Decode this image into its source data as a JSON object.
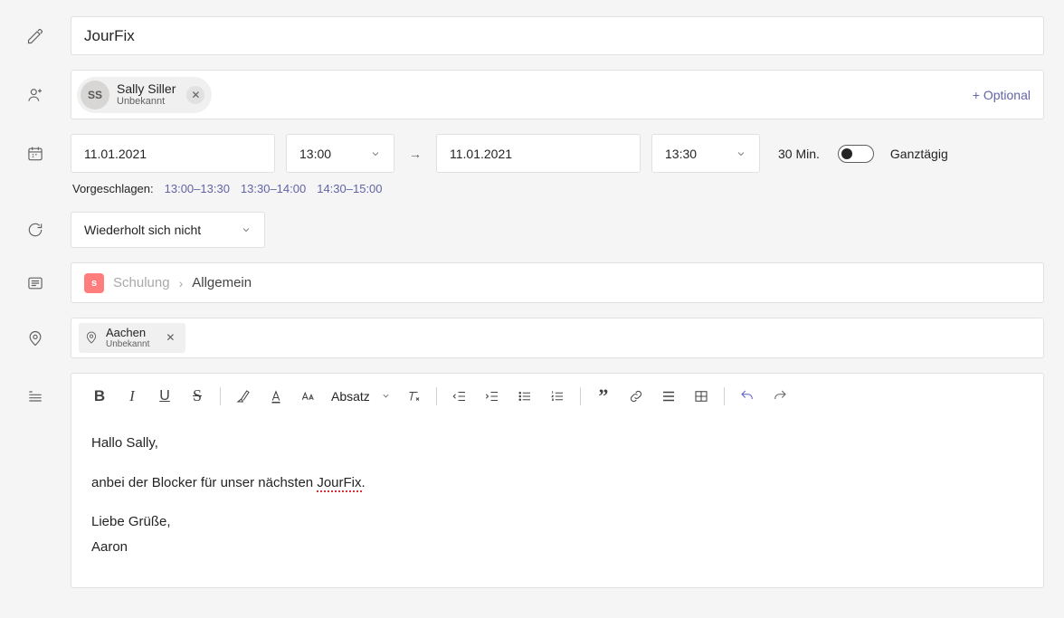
{
  "title": "JourFix",
  "attendees": {
    "chip": {
      "initials": "SS",
      "name": "Sally Siller",
      "sub": "Unbekannt"
    },
    "optional_label": "+ Optional"
  },
  "datetime": {
    "start_date": "11.01.2021",
    "start_time": "13:00",
    "end_date": "11.01.2021",
    "end_time": "13:30",
    "duration": "30 Min.",
    "allday_label": "Ganztägig"
  },
  "suggestions": {
    "label": "Vorgeschlagen:",
    "slots": [
      "13:00–13:30",
      "13:30–14:00",
      "14:30–15:00"
    ]
  },
  "recurrence": {
    "value": "Wiederholt sich nicht"
  },
  "channel": {
    "team": "Schulung",
    "channel_name": "Allgemein"
  },
  "location": {
    "name": "Aachen",
    "sub": "Unbekannt"
  },
  "toolbar": {
    "paragraph_label": "Absatz"
  },
  "body": {
    "line1": "Hallo Sally,",
    "line2_pre": "anbei der Blocker für unser nächsten ",
    "line2_word": "JourFix",
    "line2_post": ".",
    "line3": "Liebe Grüße,",
    "line4": "Aaron"
  }
}
